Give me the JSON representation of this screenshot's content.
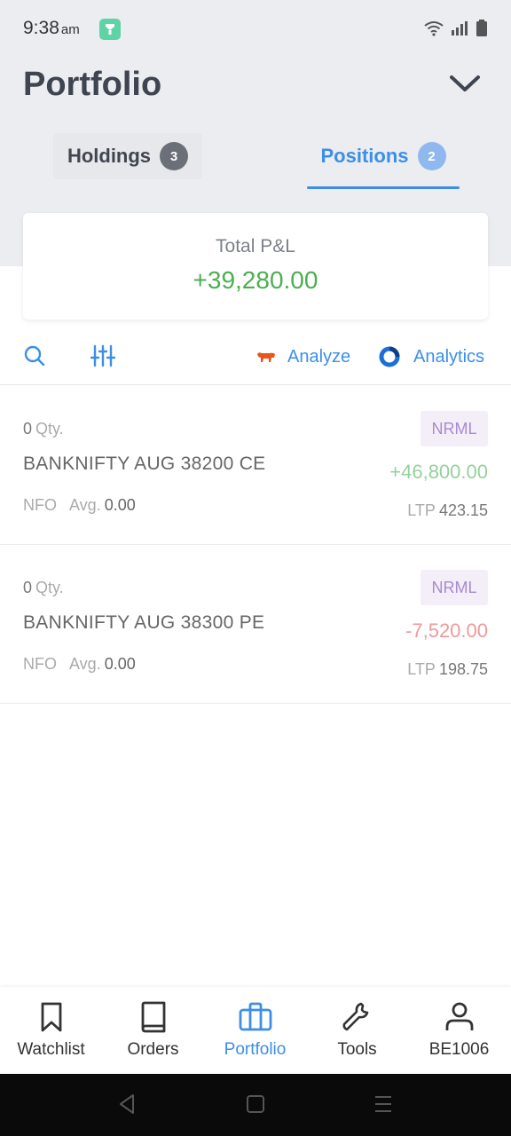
{
  "status_bar": {
    "time": "9:38",
    "ampm": "am"
  },
  "header": {
    "title": "Portfolio"
  },
  "tabs": [
    {
      "label": "Holdings",
      "count": "3",
      "active": false
    },
    {
      "label": "Positions",
      "count": "2",
      "active": true
    }
  ],
  "summary": {
    "label": "Total P&L",
    "value": "+39,280.00"
  },
  "toolbar": {
    "analyze_label": "Analyze",
    "analytics_label": "Analytics"
  },
  "positions": [
    {
      "qty": "0",
      "qty_label": "Qty.",
      "symbol": "BANKNIFTY AUG 38200 CE",
      "exchange": "NFO",
      "avg_label": "Avg.",
      "avg": "0.00",
      "product": "NRML",
      "pnl": "+46,800.00",
      "ltp_label": "LTP",
      "ltp": "423.15"
    },
    {
      "qty": "0",
      "qty_label": "Qty.",
      "symbol": "BANKNIFTY AUG 38300 PE",
      "exchange": "NFO",
      "avg_label": "Avg.",
      "avg": "0.00",
      "product": "NRML",
      "pnl": "-7,520.00",
      "ltp_label": "LTP",
      "ltp": "198.75"
    }
  ],
  "bottom_nav": [
    {
      "label": "Watchlist",
      "icon": "bookmark-icon",
      "active": false
    },
    {
      "label": "Orders",
      "icon": "book-icon",
      "active": false
    },
    {
      "label": "Portfolio",
      "icon": "briefcase-icon",
      "active": true
    },
    {
      "label": "Tools",
      "icon": "wrench-icon",
      "active": false
    },
    {
      "label": "BE1006",
      "icon": "user-icon",
      "active": false
    }
  ],
  "colors": {
    "accent": "#3c8ee8",
    "profit": "#4caf50",
    "loss": "#ef9a9a",
    "product_badge": "#a88ad0"
  }
}
